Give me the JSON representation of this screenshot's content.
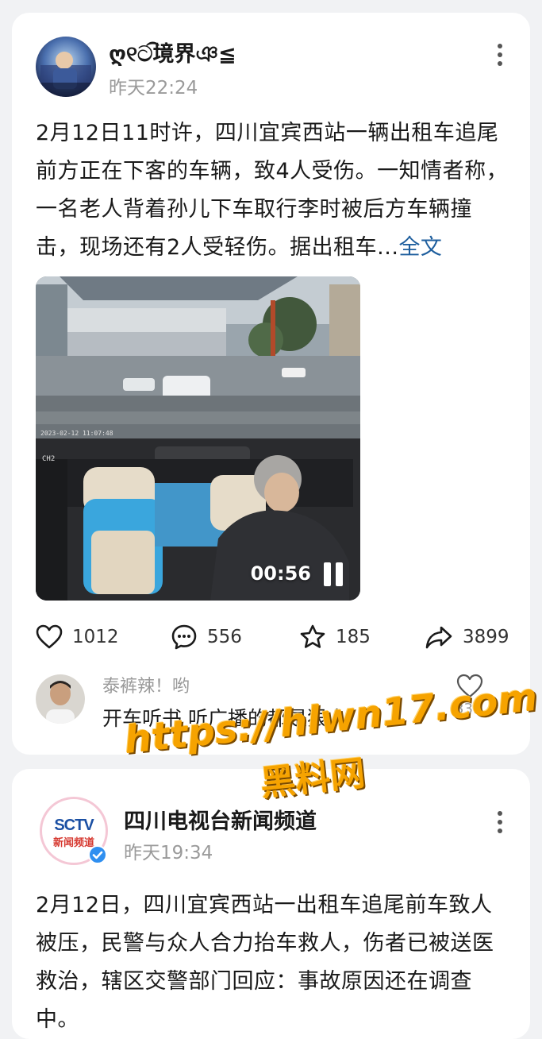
{
  "posts": [
    {
      "author_name": "ღ୧ට͡境界ঞ≦",
      "time": "昨天22:24",
      "text": "2月12日11时许，四川宜宾西站一辆出租车追尾前方正在下客的车辆，致4人受伤。一知情者称，一名老人背着孙儿下车取行李时被后方车辆撞击，现场还有2人受轻伤。据出租车...",
      "expand_label": "全文",
      "video": {
        "timecode": "00:56",
        "camera_label": "CH2",
        "state": "playing"
      },
      "actions": {
        "likes": "1012",
        "comments": "556",
        "favorites": "185",
        "shares": "3899"
      },
      "top_comment": {
        "user": "泰裤辣！哟",
        "text": "开车听书 听广播的都是狠人",
        "likes": "339"
      }
    },
    {
      "author_name": "四川电视台新闻频道",
      "avatar_logo_text": "SCTV",
      "avatar_logo_subtext": "新闻频道",
      "verified": true,
      "time": "昨天19:34",
      "text": "2月12日，四川宜宾西站一出租车追尾前车致人被压，民警与众人合力抬车救人，伤者已被送医救治，辖区交警部门回应：事故原因还在调查中。"
    }
  ],
  "watermark": {
    "line1": "https://hlwn17.com",
    "line2": "黑料网"
  },
  "colors": {
    "background": "#f1f2f4",
    "card": "#ffffff",
    "link": "#1f5f9e",
    "muted": "#9a9a9a",
    "watermark": "#f6a300",
    "verified_badge": "#2f8ff0"
  }
}
